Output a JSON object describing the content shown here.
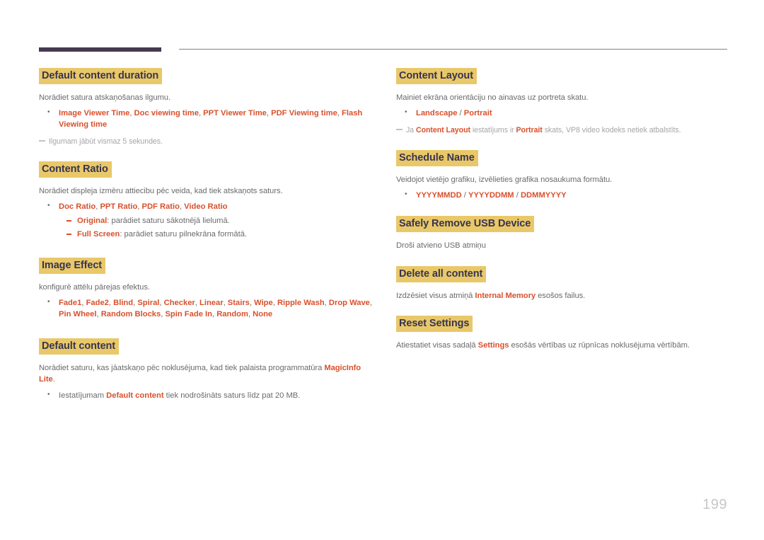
{
  "page": {
    "number": "199",
    "accent_color": "#d9502b",
    "highlight_color": "#e9c86a",
    "heading_text_color": "#37344f",
    "body_text_color": "#6b6a6e",
    "rule_thick_color": "#443a51",
    "rule_thin_color": "#808285"
  },
  "left_column": {
    "sections": [
      {
        "title": "Default content duration",
        "body_prefix": "Norādiet satura atskaņošanas ilgumu.",
        "bullet": {
          "keywords": [
            "Image Viewer Time",
            "Doc viewing time",
            "PPT Viewer Time",
            "PDF Viewing time",
            "Flash Viewing time"
          ],
          "separator": ", "
        },
        "note": {
          "prefix": "Ilgumam jābūt vismaz 5 sekundes.",
          "highlight": "",
          "suffix": ""
        }
      },
      {
        "title": "Content Ratio",
        "body_prefix": "Norādiet displeja izmēru attiecibu pēc veida, kad tiek atskaņots saturs.",
        "bullet": {
          "keywords": [
            "Doc Ratio",
            "PPT Ratio",
            "PDF Ratio",
            "Video Ratio"
          ],
          "separator": ", "
        },
        "sub_items": [
          {
            "keyword": "Original",
            "text": ": parādiet saturu sākotnējā lielumā."
          },
          {
            "keyword": "Full Screen",
            "text": ": parādiet saturu pilnekrāna formātā."
          }
        ]
      },
      {
        "title": "Image Effect",
        "body_prefix": "konfigurē attēlu pārejas efektus.",
        "bullet": {
          "keywords": [
            "Fade1",
            "Fade2",
            "Blind",
            "Spiral",
            "Checker",
            "Linear",
            "Stairs",
            "Wipe",
            "Ripple Wash",
            "Drop Wave",
            "Pin Wheel",
            "Random Blocks",
            "Spin Fade In",
            "Random",
            "None"
          ],
          "separator": ", "
        }
      },
      {
        "title": "Default content",
        "body_prefix": "Norādiet saturu, kas jāatskaņo pēc noklusējuma, kad tiek palaista programmatūra ",
        "body_highlight": "MagicInfo Lite",
        "body_suffix": ".",
        "bullet_sentence": {
          "prefix": "Iestatījumam ",
          "highlight": "Default content",
          "suffix": " tiek nodrošināts saturs līdz pat 20 MB."
        }
      }
    ]
  },
  "right_column": {
    "sections": [
      {
        "title": "Content Layout",
        "body_prefix": "Mainiet ekrāna orientāciju no ainavas uz portreta skatu.",
        "bullet": {
          "keywords": [
            "Landscape",
            "Portrait"
          ],
          "separator": " / "
        },
        "note": {
          "prefix": "Ja ",
          "highlight1": "Content Layout",
          "middle": " iestatījums ir ",
          "highlight2": "Portrait",
          "suffix": " skats, VP8 video kodeks netiek atbalstīts."
        }
      },
      {
        "title": "Schedule Name",
        "body_prefix": "Veidojot vietējo grafiku, izvēlieties grafika nosaukuma formātu.",
        "bullet": {
          "keywords": [
            "YYYYMMDD",
            "YYYYDDMM",
            "DDMMYYYY"
          ],
          "separator": " / "
        }
      },
      {
        "title": "Safely Remove USB Device",
        "body_prefix": "Droši atvieno USB atmiņu"
      },
      {
        "title": "Delete all content",
        "body_prefix": "Izdzēsiet visus atmiņā ",
        "body_highlight": "Internal Memory",
        "body_suffix": " esošos failus."
      },
      {
        "title": "Reset Settings",
        "body_prefix": "Atiestatiet visas sadaļā ",
        "body_highlight": "Settings",
        "body_suffix": " esošās vērtības uz rūpnīcas noklusējuma vērtībām."
      }
    ]
  }
}
